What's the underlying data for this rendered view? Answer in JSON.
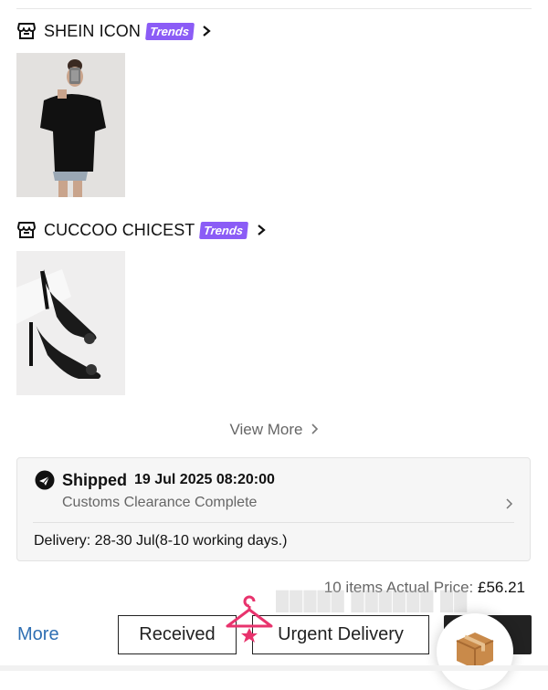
{
  "stores": [
    {
      "name": "SHEIN ICON",
      "badge": "Trends"
    },
    {
      "name": "CUCCOO CHICEST",
      "badge": "Trends"
    }
  ],
  "view_more": "View More",
  "shipment": {
    "status": "Shipped",
    "timestamp": "19 Jul 2025 08:20:00",
    "detail": "Customs Clearance Complete",
    "delivery": "Delivery: 28-30 Jul(8-10 working days.)"
  },
  "price": {
    "prefix": "10 items Actual Price:",
    "value": "£56.21"
  },
  "actions": {
    "more": "More",
    "received": "Received",
    "urgent": "Urgent Delivery"
  },
  "colors": {
    "trends_badge": "#8b5cf6",
    "more_link": "#2f6fb3",
    "hanger": "#e8336d"
  }
}
